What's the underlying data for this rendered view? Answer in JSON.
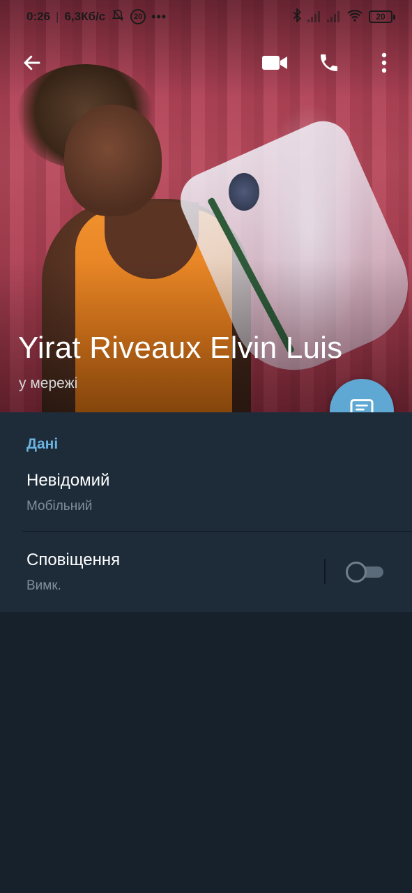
{
  "status_bar": {
    "time": "0:26",
    "separator": "|",
    "network_speed": "6,3Кб/с",
    "notification_count": "20",
    "more": "•••",
    "battery_level": "20"
  },
  "toolbar": {
    "back_icon": "arrow-left-icon",
    "video_call_icon": "video-camera-icon",
    "call_icon": "phone-icon",
    "more_icon": "more-vertical-icon"
  },
  "profile": {
    "name": "Yirat Riveaux Elvin Luis",
    "status": "у мережі",
    "fab_icon": "message-icon"
  },
  "info": {
    "section_title": "Дані",
    "phone_value": "Невідомий",
    "phone_label": "Мобільний",
    "notifications_title": "Сповіщення",
    "notifications_value": "Вимк.",
    "notifications_enabled": false
  },
  "colors": {
    "accent": "#5fa8d3",
    "section_title": "#6ab3e0",
    "background": "#17212b",
    "panel": "#1e2c3a"
  }
}
